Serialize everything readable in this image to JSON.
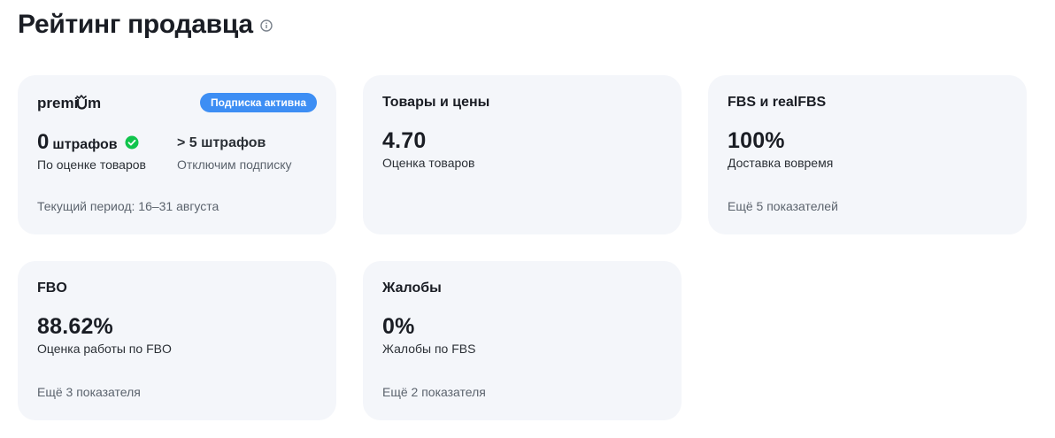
{
  "header": {
    "title": "Рейтинг продавца",
    "info_icon": "info-icon"
  },
  "premium_card": {
    "logo_text": "premium",
    "badge": "Подписка активна",
    "fines_value": "0",
    "fines_unit": "штрафов",
    "fines_desc": "По оценке товаров",
    "threshold": "> 5 штрафов",
    "threshold_desc": "Отключим подписку",
    "period": "Текущий период: 16–31 августа",
    "colors": {
      "badge": "#3d8ef4",
      "check": "#10c44c"
    }
  },
  "cards": [
    {
      "title": "Товары и цены",
      "value": "4.70",
      "desc": "Оценка товаров",
      "more": ""
    },
    {
      "title": "FBS и realFBS",
      "value": "100%",
      "desc": "Доставка вовремя",
      "more": "Ещё 5 показателей"
    },
    {
      "title": "FBO",
      "value": "88.62%",
      "desc": "Оценка работы по FBO",
      "more": "Ещё 3 показателя"
    },
    {
      "title": "Жалобы",
      "value": "0%",
      "desc": "Жалобы по FBS",
      "more": "Ещё 2 показателя"
    }
  ]
}
